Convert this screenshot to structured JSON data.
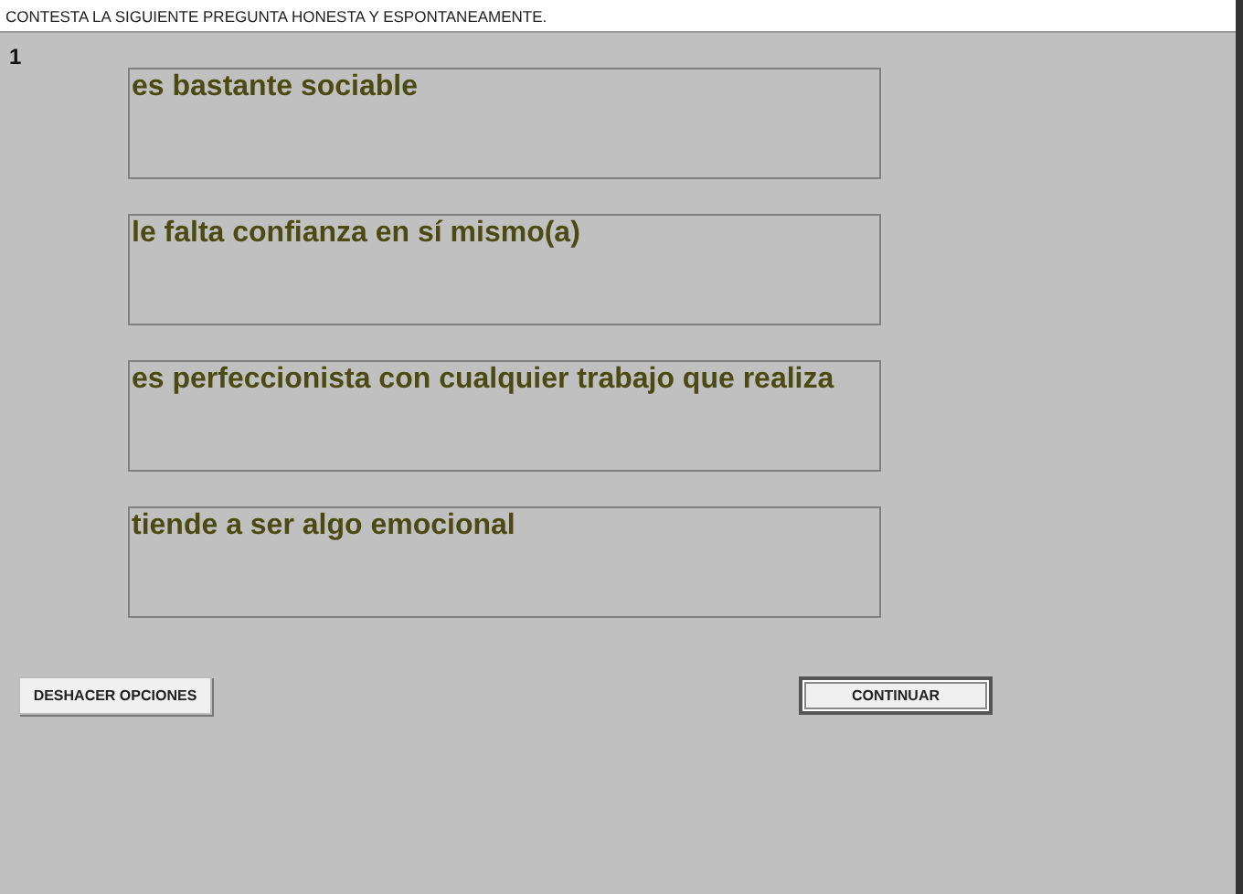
{
  "instruction": "CONTESTA LA SIGUIENTE PREGUNTA HONESTA Y ESPONTANEAMENTE.",
  "question_number": "1",
  "options": [
    {
      "label": "es bastante sociable"
    },
    {
      "label": "le falta confianza en sí mismo(a)"
    },
    {
      "label": "es perfeccionista con cualquier trabajo que realiza"
    },
    {
      "label": "tiende a ser algo emocional"
    }
  ],
  "buttons": [
    {
      "label": "DESHACER OPCIONES",
      "kind": "plain"
    },
    {
      "label": "CONTINUAR",
      "kind": "default"
    }
  ]
}
